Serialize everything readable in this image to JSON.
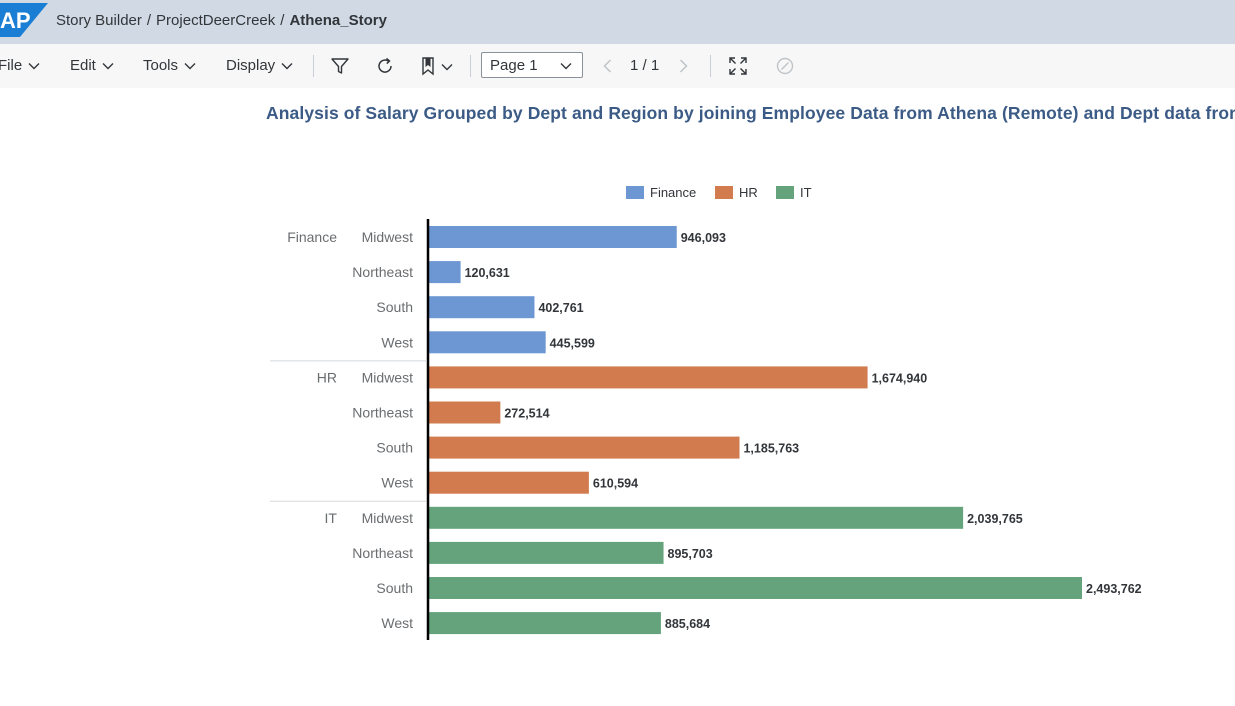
{
  "shell": {
    "logo_text": "AP",
    "breadcrumb": [
      "Story Builder",
      "ProjectDeerCreek"
    ],
    "current": "Athena_Story",
    "separator": "/"
  },
  "toolbar": {
    "menus": [
      "File",
      "Edit",
      "Tools",
      "Display"
    ],
    "page_select": "Page 1",
    "page_indicator": "1 / 1",
    "icons": [
      "filter-icon",
      "refresh-icon",
      "bookmark-icon",
      "fullscreen-icon",
      "disabled-circle-icon"
    ]
  },
  "chart_data": {
    "type": "bar",
    "orientation": "horizontal",
    "title": "Analysis of Salary Grouped by Dept and Region by joining Employee Data from Athena (Remote) and  Dept data from Lo",
    "legend": [
      {
        "name": "Finance",
        "color": "#6c97d3"
      },
      {
        "name": "HR",
        "color": "#d17b4f"
      },
      {
        "name": "IT",
        "color": "#64a37c"
      }
    ],
    "legend_position": "top",
    "groups": [
      {
        "name": "Finance",
        "color": "#6c97d3",
        "categories": [
          "Midwest",
          "Northeast",
          "South",
          "West"
        ],
        "values": [
          946093,
          120631,
          402761,
          445599
        ],
        "labels": [
          "946,093",
          "120,631",
          "402,761",
          "445,599"
        ]
      },
      {
        "name": "HR",
        "color": "#d17b4f",
        "categories": [
          "Midwest",
          "Northeast",
          "South",
          "West"
        ],
        "values": [
          1674940,
          272514,
          1185763,
          610594
        ],
        "labels": [
          "1,674,940",
          "272,514",
          "1,185,763",
          "610,594"
        ]
      },
      {
        "name": "IT",
        "color": "#64a37c",
        "categories": [
          "Midwest",
          "Northeast",
          "South",
          "West"
        ],
        "values": [
          2039765,
          895703,
          2493762,
          885684
        ],
        "labels": [
          "2,039,765",
          "895,703",
          "2,493,762",
          "885,684"
        ]
      }
    ],
    "xlim": [
      0,
      2493762
    ],
    "grid": false
  }
}
